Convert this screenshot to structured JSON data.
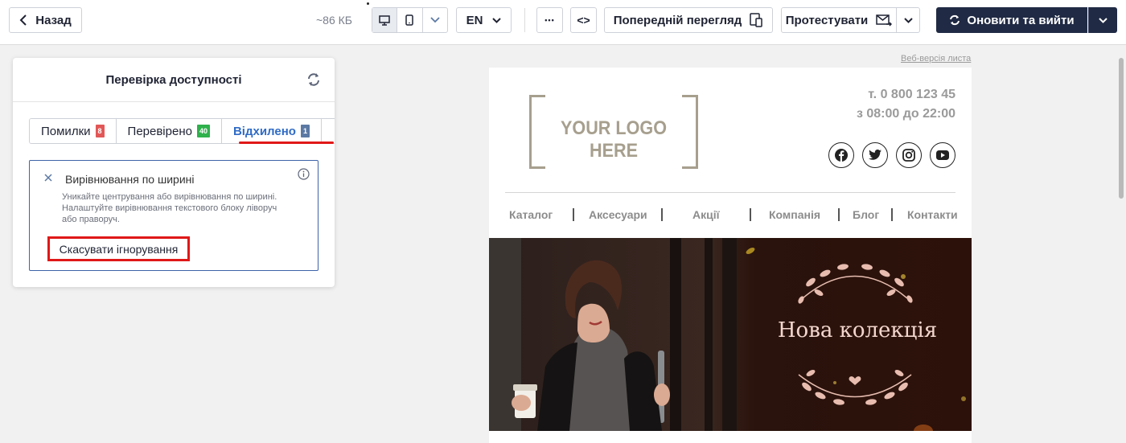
{
  "toolbar": {
    "back_label": "Назад",
    "size_label": "~86 КБ",
    "lang_label": "EN",
    "more_label": "•••",
    "code_label": "<>",
    "preview_label": "Попередній перегляд",
    "test_label": "Протестувати",
    "update_label": "Оновити та вийти"
  },
  "panel": {
    "title": "Перевірка доступності",
    "tabs": [
      {
        "label": "Помилки",
        "count": "8",
        "color": "#e25757"
      },
      {
        "label": "Перевірено",
        "count": "40",
        "color": "#2fb14c"
      },
      {
        "label": "Відхилено",
        "count": "1",
        "color": "#5c79a4"
      }
    ],
    "issue": {
      "title": "Вирівнювання по ширині",
      "description": "Уникайте центрування або вирівнювання по ширині. Налаштуйте вирівнювання текстового блоку ліворуч або праворуч.",
      "undo_label": "Скасувати ігнорування"
    }
  },
  "email": {
    "web_version_link": "Веб-версія листа",
    "logo_text": "YOUR LOGO HERE",
    "phone": "т. 0 800 123 45",
    "hours": "з 08:00 до 22:00",
    "socials": [
      "facebook-icon",
      "twitter-icon",
      "instagram-icon",
      "youtube-icon"
    ],
    "nav": [
      "Каталог",
      "Аксесуари",
      "Акції",
      "Компанія",
      "Блог",
      "Контакти"
    ],
    "hero_title": "Нова колекція"
  },
  "colors": {
    "accent": "#202a44",
    "highlight": "#e01818",
    "tab_active": "#2f6bc6",
    "logo": "#a79f8e"
  }
}
